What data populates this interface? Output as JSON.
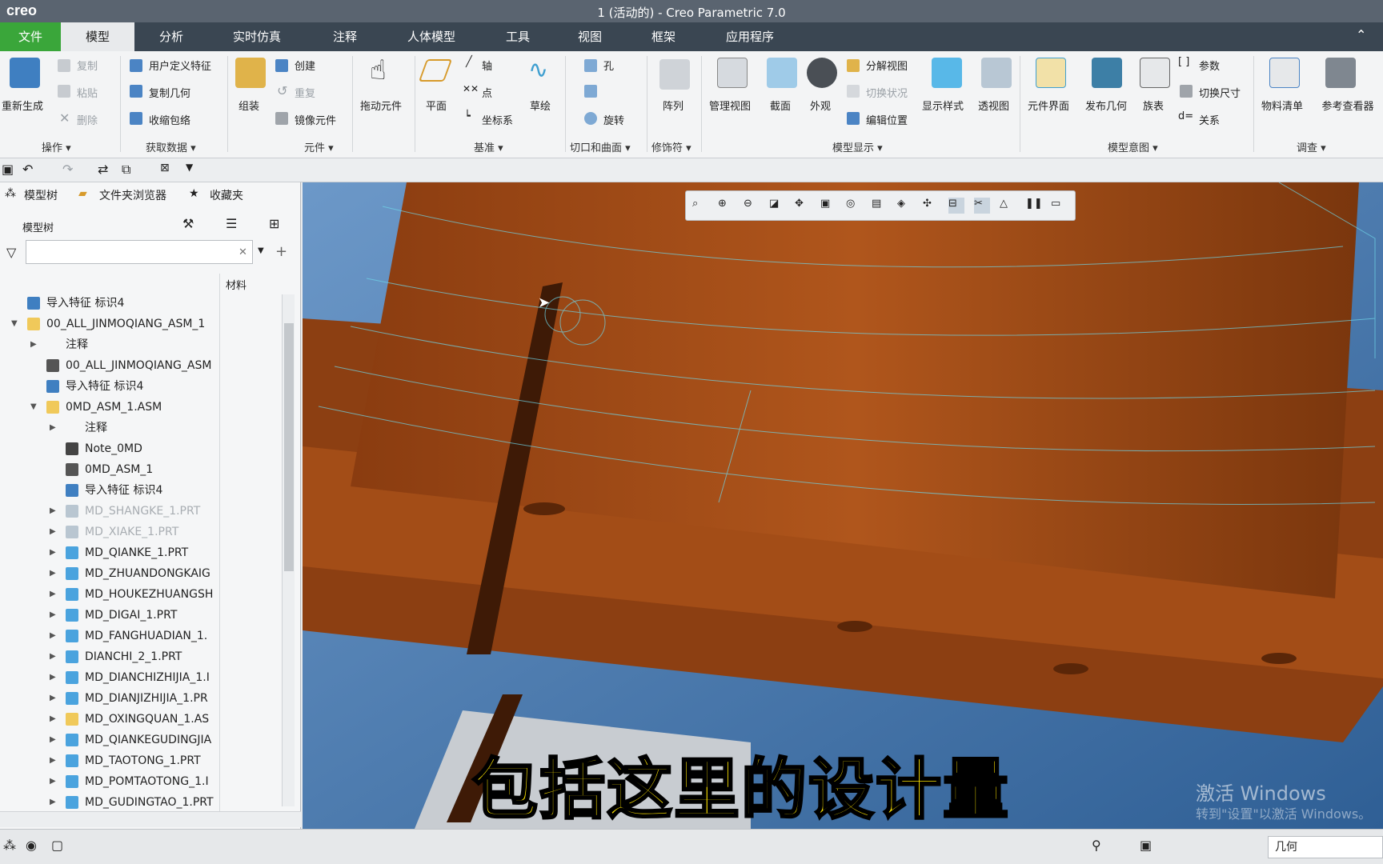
{
  "window": {
    "app_logo": "creo",
    "title": "1 (活动的) - Creo Parametric 7.0"
  },
  "menu": {
    "tabs": [
      "文件",
      "模型",
      "分析",
      "实时仿真",
      "注释",
      "人体模型",
      "工具",
      "视图",
      "框架",
      "应用程序"
    ]
  },
  "ribbon": {
    "regenerate": "重新生成",
    "copy": "复制",
    "paste": "粘贴",
    "delete": "删除",
    "user_feature": "用户定义特征",
    "copy_geometry": "复制几何",
    "shrinkwrap": "收缩包络",
    "assemble": "组装",
    "create": "创建",
    "repeat": "重复",
    "mirror_component": "镜像元件",
    "drag_components": "拖动元件",
    "plane": "平面",
    "axis": "轴",
    "point": "点",
    "csys": "坐标系",
    "sketch": "草绘",
    "hole": "孔",
    "revolve": "旋转",
    "pattern": "阵列",
    "manage_views": "管理视图",
    "section": "截面",
    "appearance": "外观",
    "exploded_view": "分解视图",
    "toggle_status": "切换状况",
    "edit_position": "编辑位置",
    "display_style": "显示样式",
    "perspective_view": "透视图",
    "component_interface": "元件界面",
    "publish_geometry": "发布几何",
    "family_table": "族表",
    "parameters": "参数",
    "switch_dimensions": "切换尺寸",
    "relations": "关系",
    "bill_of_materials": "物料清单",
    "reference_viewer": "参考查看器",
    "groups": [
      "操作 ▾",
      "获取数据 ▾",
      "元件 ▾",
      "基准 ▾",
      "切口和曲面 ▾",
      "修饰符 ▾",
      "模型显示 ▾",
      "模型意图 ▾",
      "调查 ▾"
    ]
  },
  "panel": {
    "tabs": [
      "模型树",
      "文件夹浏览器",
      "收藏夹"
    ],
    "tree_title": "模型树",
    "filter_placeholder": "",
    "column_material": "材料"
  },
  "tree": [
    {
      "label": "导入特征 标识4",
      "indent": 0,
      "arrow": "",
      "type": "import"
    },
    {
      "label": "00_ALL_JINMOQIANG_ASM_1",
      "indent": 0,
      "arrow": "▼",
      "type": "asm"
    },
    {
      "label": "注释",
      "indent": 1,
      "arrow": "▶",
      "type": "none"
    },
    {
      "label": "00_ALL_JINMOQIANG_ASM",
      "indent": 1,
      "arrow": "",
      "type": "csys"
    },
    {
      "label": "导入特征 标识4",
      "indent": 1,
      "arrow": "",
      "type": "import"
    },
    {
      "label": "0MD_ASM_1.ASM",
      "indent": 1,
      "arrow": "▼",
      "type": "asm"
    },
    {
      "label": "注释",
      "indent": 2,
      "arrow": "▶",
      "type": "none"
    },
    {
      "label": "Note_0MD",
      "indent": 2,
      "arrow": "",
      "type": "note"
    },
    {
      "label": "0MD_ASM_1",
      "indent": 2,
      "arrow": "",
      "type": "csys"
    },
    {
      "label": "导入特征 标识4",
      "indent": 2,
      "arrow": "",
      "type": "import"
    },
    {
      "label": "MD_SHANGKE_1.PRT",
      "indent": 2,
      "arrow": "▶",
      "type": "part-grey"
    },
    {
      "label": "MD_XIAKE_1.PRT",
      "indent": 2,
      "arrow": "▶",
      "type": "part-grey"
    },
    {
      "label": "MD_QIANKE_1.PRT",
      "indent": 2,
      "arrow": "▶",
      "type": "part"
    },
    {
      "label": "MD_ZHUANDONGKAIG",
      "indent": 2,
      "arrow": "▶",
      "type": "part"
    },
    {
      "label": "MD_HOUKEZHUANGSH",
      "indent": 2,
      "arrow": "▶",
      "type": "part"
    },
    {
      "label": "MD_DIGAI_1.PRT",
      "indent": 2,
      "arrow": "▶",
      "type": "part"
    },
    {
      "label": "MD_FANGHUADIAN_1.",
      "indent": 2,
      "arrow": "▶",
      "type": "part"
    },
    {
      "label": "DIANCHI_2_1.PRT",
      "indent": 2,
      "arrow": "▶",
      "type": "part"
    },
    {
      "label": "MD_DIANCHIZHIJIA_1.I",
      "indent": 2,
      "arrow": "▶",
      "type": "part"
    },
    {
      "label": "MD_DIANJIZHIJIA_1.PR",
      "indent": 2,
      "arrow": "▶",
      "type": "part"
    },
    {
      "label": "MD_OXINGQUAN_1.AS",
      "indent": 2,
      "arrow": "▶",
      "type": "asm"
    },
    {
      "label": "MD_QIANKEGUDINGJIA",
      "indent": 2,
      "arrow": "▶",
      "type": "part"
    },
    {
      "label": "MD_TAOTONG_1.PRT",
      "indent": 2,
      "arrow": "▶",
      "type": "part"
    },
    {
      "label": "MD_POMTAOTONG_1.I",
      "indent": 2,
      "arrow": "▶",
      "type": "part"
    },
    {
      "label": "MD_GUDINGTAO_1.PRT",
      "indent": 2,
      "arrow": "▶",
      "type": "part"
    }
  ],
  "viewport": {
    "caption": "包括这里的设计量",
    "watermark_line1": "激活 Windows",
    "watermark_line2": "转到\"设置\"以激活 Windows。"
  },
  "status": {
    "filter_value": "几何"
  },
  "colors": {
    "part_color": "#9a4a16",
    "background": "#3f78b8",
    "accent_green": "#3aa63a",
    "menu_bg": "#3a4652"
  }
}
